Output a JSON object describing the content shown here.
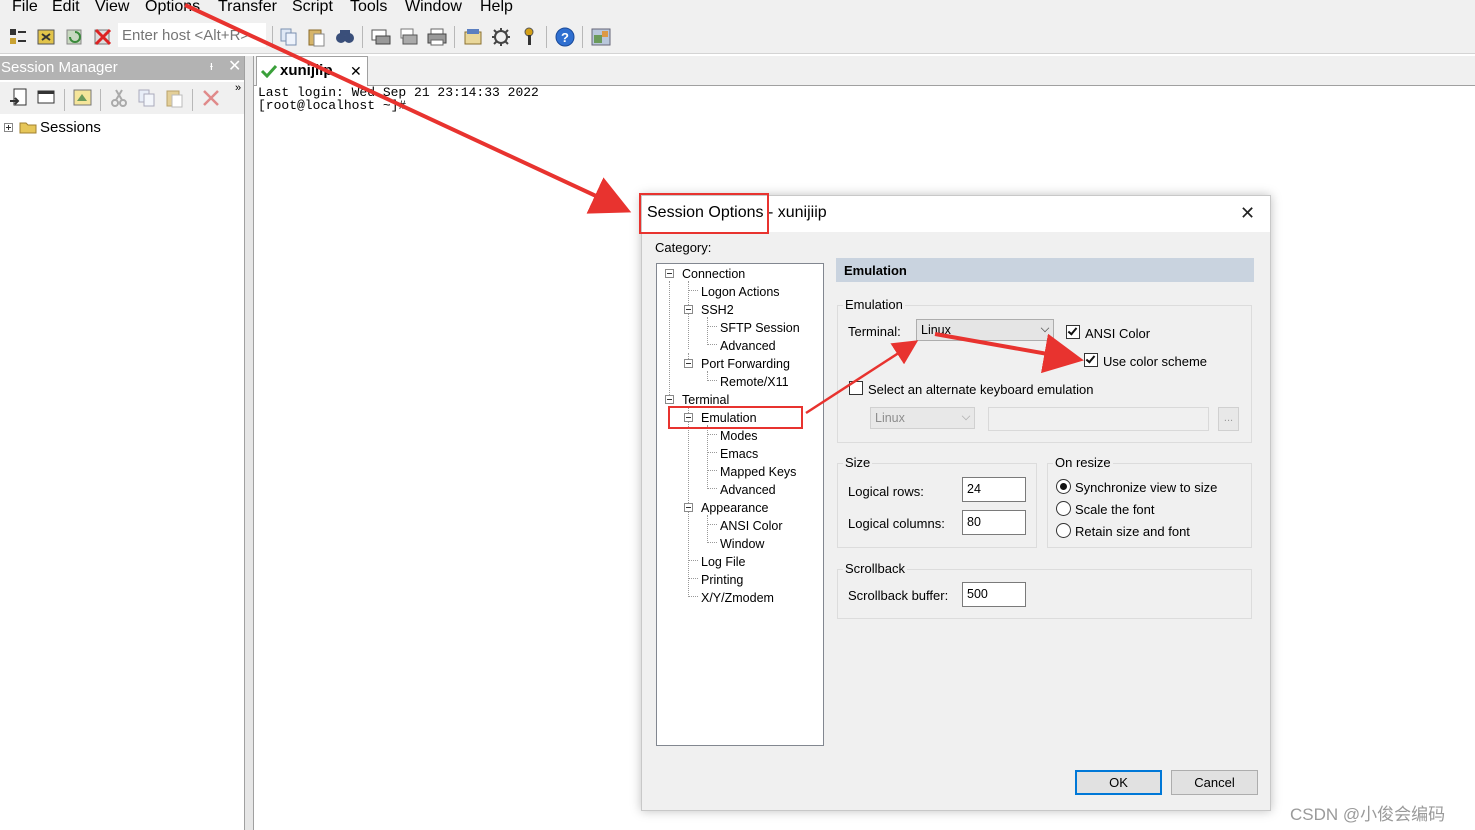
{
  "menu": [
    "File",
    "Edit",
    "View",
    "Options",
    "Transfer",
    "Script",
    "Tools",
    "Window",
    "Help"
  ],
  "toolbar": {
    "host_placeholder": "Enter host <Alt+R>",
    "icons": [
      "connect-icon",
      "quick-connect-icon",
      "reconnect-icon",
      "disconnect-icon",
      "copy-icon",
      "paste-icon",
      "find-icon",
      "print-setup-icon",
      "print-selection-icon",
      "print-icon",
      "session-options-icon",
      "global-options-icon",
      "keymap-icon",
      "help-icon",
      "sftp-icon"
    ]
  },
  "session_manager": {
    "title": "Session Manager",
    "pin": "ᵻ",
    "close": "✕",
    "tree_root": "Sessions"
  },
  "tab": {
    "label": "xunijiip",
    "close": "✕"
  },
  "terminal": {
    "lines": [
      "Last login: Wed Sep 21 23:14:33 2022",
      "[root@localhost ~]#"
    ]
  },
  "dialog": {
    "title": "Session Options - xunijiip",
    "close": "✕",
    "category_label": "Category:",
    "tree": [
      "Connection",
      "Logon Actions",
      "SSH2",
      "SFTP Session",
      "Advanced",
      "Port Forwarding",
      "Remote/X11",
      "Terminal",
      "Emulation",
      "Modes",
      "Emacs",
      "Mapped Keys",
      "Advanced",
      "Appearance",
      "ANSI Color",
      "Window",
      "Log File",
      "Printing",
      "X/Y/Zmodem"
    ],
    "panel_title": "Emulation",
    "emulation": {
      "group_title": "Emulation",
      "terminal_label": "Terminal:",
      "terminal_value": "Linux",
      "ansi_color_label": "ANSI Color",
      "ansi_color_checked": true,
      "color_scheme_label": "Use color scheme",
      "color_scheme_checked": true,
      "alt_keyboard_label": "Select an alternate keyboard emulation",
      "alt_keyboard_checked": false,
      "alt_keyboard_value": "Linux",
      "ellipsis": "..."
    },
    "size": {
      "group_title": "Size",
      "rows_label": "Logical rows:",
      "rows_value": "24",
      "cols_label": "Logical columns:",
      "cols_value": "80"
    },
    "on_resize": {
      "group_title": "On resize",
      "options": [
        "Synchronize view to size",
        "Scale the font",
        "Retain size and font"
      ],
      "selected": "Synchronize view to size"
    },
    "scrollback": {
      "group_title": "Scrollback",
      "buffer_label": "Scrollback buffer:",
      "buffer_value": "500"
    },
    "ok_label": "OK",
    "cancel_label": "Cancel"
  },
  "annotation_color": "#e8332f",
  "watermark": "CSDN @小俊会编码"
}
